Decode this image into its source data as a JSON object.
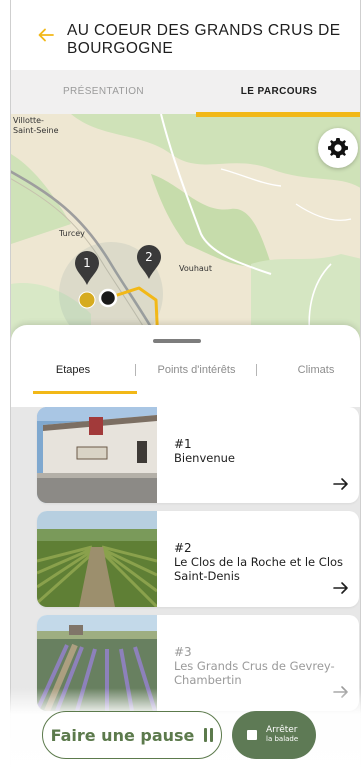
{
  "header": {
    "title": "AU COEUR DES GRANDS CRUS DE BOURGOGNE"
  },
  "tabs": [
    {
      "label": "PRÉSENTATION",
      "selected": false
    },
    {
      "label": "LE PARCOURS",
      "selected": true
    }
  ],
  "map": {
    "labels": [
      "Villotte-Saint-Seine",
      "Turcey",
      "Vouhaut"
    ],
    "markers": [
      "1",
      "2"
    ]
  },
  "subtabs": [
    {
      "label": "Etapes",
      "selected": true
    },
    {
      "label": "Points d'intérêts",
      "selected": false
    },
    {
      "label": "Climats",
      "selected": false
    }
  ],
  "steps": [
    {
      "number": "#1",
      "name": "Bienvenue"
    },
    {
      "number": "#2",
      "name": "Le Clos de la Roche et le Clos Saint-Denis"
    },
    {
      "number": "#3",
      "name": "Les Grands Crus de Gevrey-Chambertin"
    }
  ],
  "actions": {
    "pause_label": "Faire une pause",
    "stop_line1": "Arrêter",
    "stop_line2": "la balade"
  },
  "colors": {
    "accent": "#f2b817",
    "green": "#5c7a4c",
    "list_bg": "#e7e7e7"
  },
  "icons": [
    "back-arrow-icon",
    "gear-icon",
    "map-pin-icon",
    "arrow-right-icon",
    "pause-icon",
    "stop-icon"
  ]
}
